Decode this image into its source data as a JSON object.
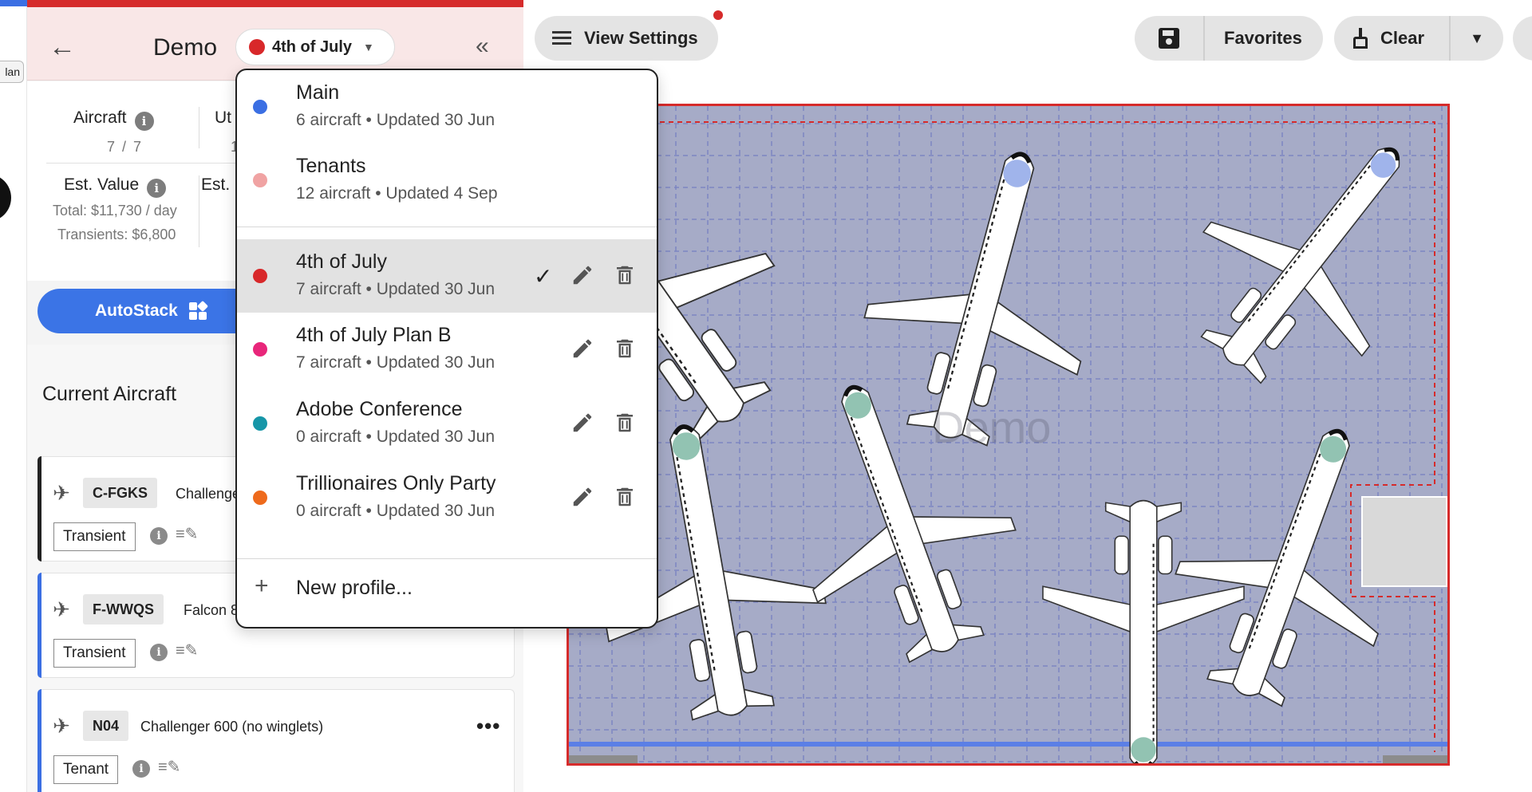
{
  "edge": {
    "plan_chip": "lan"
  },
  "header": {
    "title": "Demo",
    "profile_chip": "4th of July",
    "profile_color": "#d8282a"
  },
  "stats": {
    "aircraft_label": "Aircraft",
    "aircraft_value": "7 / 7",
    "util_label": "Ut",
    "util_value": "1",
    "est_value_label": "Est. Value",
    "est_value_total": "Total: $11,730 / day",
    "est_value_transients": "Transients: $6,800",
    "est2_label": "Est."
  },
  "autostack": {
    "label": "AutoStack"
  },
  "current": {
    "title": "Current Aircraft",
    "cards": [
      {
        "tail": "C-FGKS",
        "model": "Challenge",
        "type": "Transient",
        "accent": "#222222"
      },
      {
        "tail": "F-WWQS",
        "model": "Falcon 8",
        "type": "Transient",
        "accent": "#3b6fe3"
      },
      {
        "tail": "N04",
        "model": "Challenger 600 (no winglets)",
        "type": "Tenant",
        "accent": "#3b6fe3",
        "more": "•••"
      }
    ]
  },
  "toolbar": {
    "view_settings": "View Settings",
    "favorites": "Favorites",
    "clear": "Clear"
  },
  "hangar": {
    "watermark": "Demo",
    "border_color": "#d62b2b",
    "floor_color": "#a6abc7"
  },
  "dropdown": {
    "profiles": [
      {
        "name": "Main",
        "meta": "6 aircraft • Updated 30 Jun",
        "color": "#3b6fe3"
      },
      {
        "name": "Tenants",
        "meta": "12 aircraft • Updated 4 Sep",
        "color": "#f0a3a3"
      },
      {
        "name": "4th of July",
        "meta": "7 aircraft • Updated 30 Jun",
        "color": "#d8282a",
        "selected": true
      },
      {
        "name": "4th of July Plan B",
        "meta": "7 aircraft • Updated 30 Jun",
        "color": "#e8267a"
      },
      {
        "name": "Adobe Conference",
        "meta": "0 aircraft • Updated 30 Jun",
        "color": "#1696a8"
      },
      {
        "name": "Trillionaires Only Party",
        "meta": "0 aircraft • Updated 30 Jun",
        "color": "#ee6a1c"
      }
    ],
    "new_profile": "New profile..."
  }
}
